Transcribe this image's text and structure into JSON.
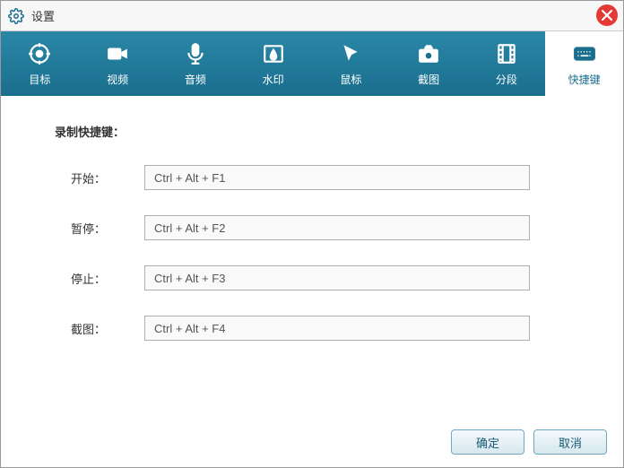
{
  "window": {
    "title": "设置"
  },
  "tabs": [
    {
      "label": "目标"
    },
    {
      "label": "视频"
    },
    {
      "label": "音频"
    },
    {
      "label": "水印"
    },
    {
      "label": "鼠标"
    },
    {
      "label": "截图"
    },
    {
      "label": "分段"
    },
    {
      "label": "快捷键"
    }
  ],
  "section": {
    "title": "录制快捷键："
  },
  "shortcuts": {
    "start": {
      "label": "开始：",
      "value": "Ctrl + Alt + F1"
    },
    "pause": {
      "label": "暂停：",
      "value": "Ctrl + Alt + F2"
    },
    "stop": {
      "label": "停止：",
      "value": "Ctrl + Alt + F3"
    },
    "shot": {
      "label": "截图：",
      "value": "Ctrl + Alt + F4"
    }
  },
  "buttons": {
    "ok": "确定",
    "cancel": "取消"
  }
}
